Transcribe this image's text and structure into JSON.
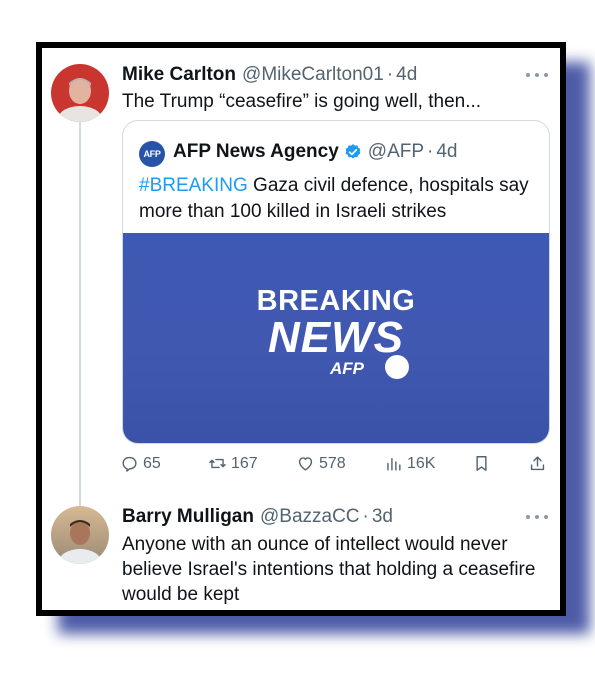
{
  "tweet1": {
    "name": "Mike Carlton",
    "handle": "@MikeCarlton01",
    "sep": "·",
    "time": "4d",
    "text": "The Trump “ceasefire” is going well, then...",
    "quote": {
      "logo_text": "AFP",
      "name": "AFP News Agency",
      "handle": "@AFP",
      "sep": "·",
      "time": "4d",
      "hashtag": "#BREAKING",
      "text": " Gaza civil defence, hospitals say more than 100 killed in Israeli strikes",
      "media": {
        "line1": "BREAKING",
        "line2": "NEWS",
        "brand": "AFP"
      }
    },
    "actions": {
      "replies": "65",
      "retweets": "167",
      "likes": "578",
      "views": "16K"
    }
  },
  "tweet2": {
    "name": "Barry Mulligan",
    "handle": "@BazzaCC",
    "sep": "·",
    "time": "3d",
    "text": "Anyone with an ounce of intellect would never believe Israel's intentions that holding a ceasefire would be kept"
  },
  "colors": {
    "link": "#1d9bf0",
    "muted": "#536471",
    "media_bg": "#3e59b3",
    "verified": "#1d9bf0",
    "frame_shadow": "#3b4a9e"
  },
  "icons": [
    "more-icon",
    "verified-icon",
    "reply-icon",
    "retweet-icon",
    "like-icon",
    "views-icon",
    "bookmark-icon",
    "share-icon"
  ]
}
